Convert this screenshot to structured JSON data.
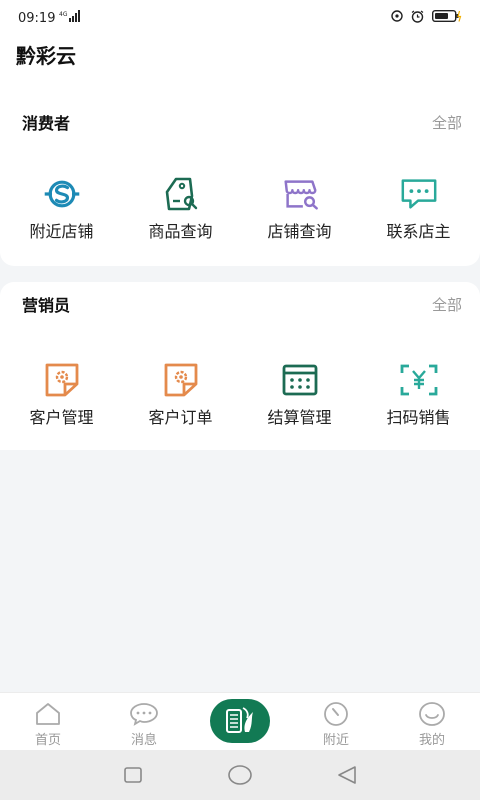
{
  "status_bar": {
    "time": "09:19",
    "network_icon": "signal-icon",
    "right_icons": [
      "location-icon",
      "alarm-icon",
      "battery-icon"
    ]
  },
  "header": {
    "title": "黔彩云"
  },
  "consumer": {
    "title": "消费者",
    "see_all": "全部",
    "items": [
      {
        "label": "附近店铺",
        "icon": "nearby-store-icon",
        "color": "#1d8ab5"
      },
      {
        "label": "商品查询",
        "icon": "product-search-icon",
        "color": "#1c6b53"
      },
      {
        "label": "店铺查询",
        "icon": "store-search-icon",
        "color": "#8e74c9"
      },
      {
        "label": "联系店主",
        "icon": "chat-icon",
        "color": "#29a99a"
      }
    ]
  },
  "marketer": {
    "title": "营销员",
    "see_all": "全部",
    "items": [
      {
        "label": "客户管理",
        "icon": "customer-management-icon",
        "color": "#e48a4c"
      },
      {
        "label": "客户订单",
        "icon": "customer-order-icon",
        "color": "#e48a4c"
      },
      {
        "label": "结算管理",
        "icon": "settlement-icon",
        "color": "#1c6b53"
      },
      {
        "label": "扫码销售",
        "icon": "scan-sale-icon",
        "color": "#29a99a"
      }
    ]
  },
  "tab_bar": {
    "tabs": [
      {
        "label": "首页",
        "icon": "home-icon"
      },
      {
        "label": "消息",
        "icon": "message-icon"
      },
      {
        "label": "",
        "icon": "brand-logo-icon"
      },
      {
        "label": "附近",
        "icon": "compass-icon"
      },
      {
        "label": "我的",
        "icon": "profile-icon"
      }
    ],
    "brand_color": "#127a54"
  },
  "system_nav": {
    "buttons": [
      "recent-apps-icon",
      "home-circle-icon",
      "back-triangle-icon"
    ]
  }
}
